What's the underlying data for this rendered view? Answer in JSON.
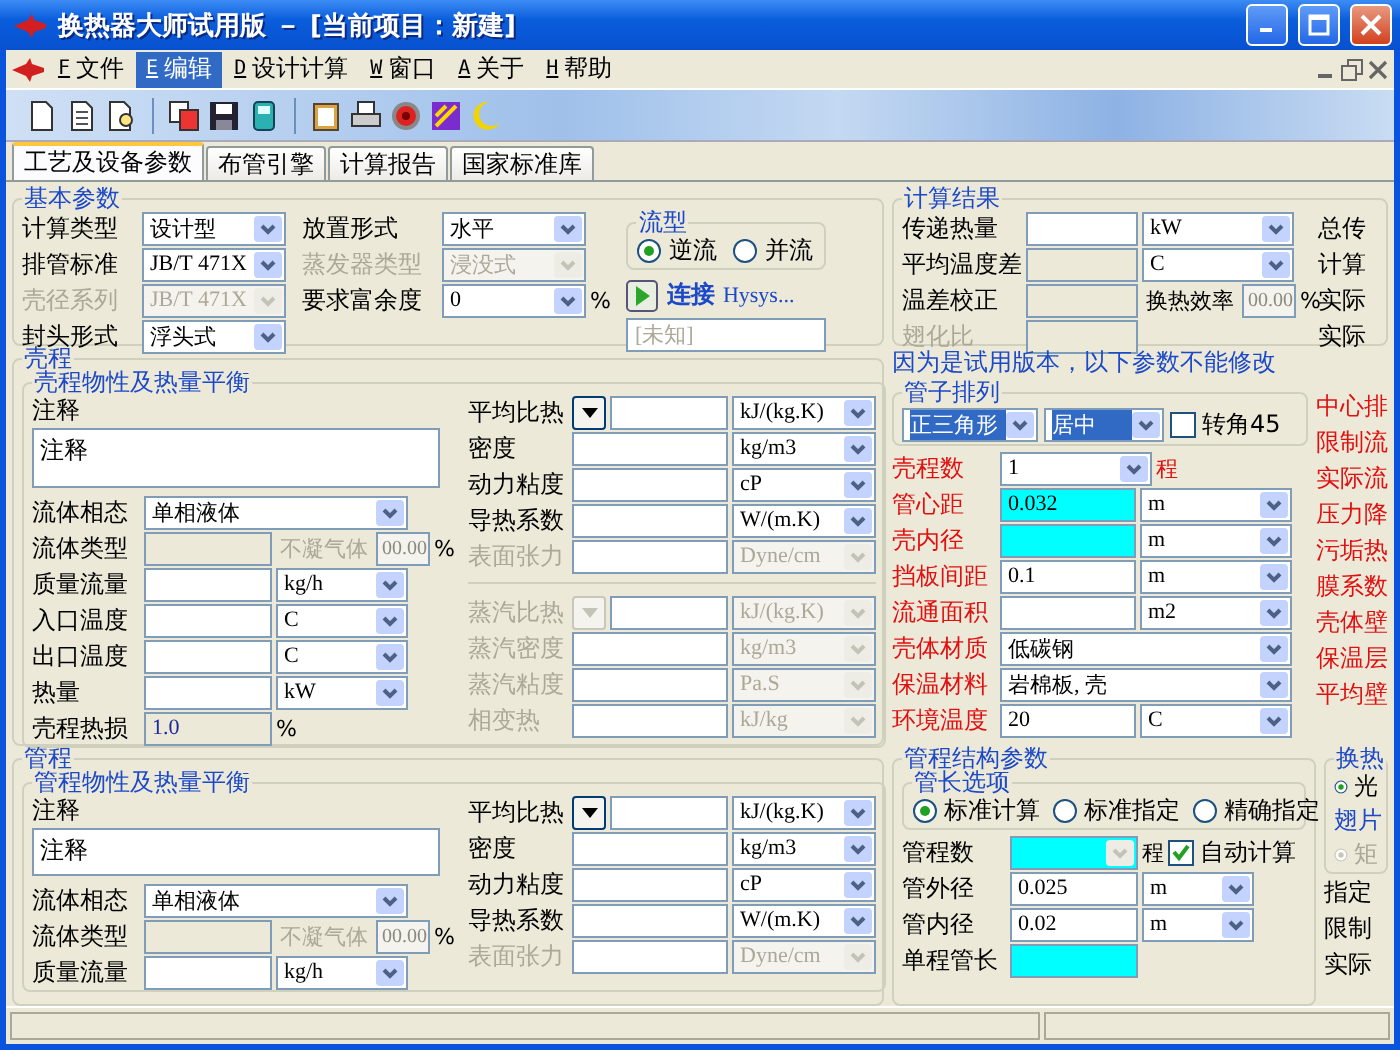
{
  "window": {
    "title": "换热器大师试用版 － [当前项目：新建]"
  },
  "menu": [
    {
      "key": "F",
      "label": "文件",
      "selected": false
    },
    {
      "key": "E",
      "label": "编辑",
      "selected": true
    },
    {
      "key": "D",
      "label": "设计计算",
      "selected": false
    },
    {
      "key": "W",
      "label": "窗口",
      "selected": false
    },
    {
      "key": "A",
      "label": "关于",
      "selected": false
    },
    {
      "key": "H",
      "label": "帮助",
      "selected": false
    }
  ],
  "tabs": [
    {
      "label": "工艺及设备参数",
      "selected": true
    },
    {
      "label": "布管引擎",
      "selected": false
    },
    {
      "label": "计算报告",
      "selected": false
    },
    {
      "label": "国家标准库",
      "selected": false
    }
  ],
  "basic": {
    "title": "基本参数",
    "column_1": [
      {
        "label": "计算类型",
        "disabled": false,
        "cells": [
          {
            "kind": "combo",
            "value": "设计型"
          }
        ]
      },
      {
        "label": "排管标准",
        "disabled": false,
        "cells": [
          {
            "kind": "combo",
            "value": "JB/T 471X"
          }
        ]
      },
      {
        "label": "壳径系列",
        "disabled": true,
        "cells": [
          {
            "kind": "combo",
            "value": "JB/T 471X"
          }
        ]
      },
      {
        "label": "封头形式",
        "disabled": false,
        "cells": [
          {
            "kind": "combo",
            "value": "浮头式"
          }
        ]
      }
    ],
    "column_2": [
      {
        "label": "放置形式",
        "disabled": false,
        "cells": [
          {
            "kind": "combo",
            "value": "水平"
          }
        ]
      },
      {
        "label": "蒸发器类型",
        "disabled": true,
        "cells": [
          {
            "kind": "combo",
            "value": "浸没式"
          }
        ]
      },
      {
        "label": "要求富余度",
        "disabled": false,
        "cells": [
          {
            "kind": "combo",
            "value": "0"
          },
          {
            "kind": "suffix",
            "value": "%"
          }
        ]
      }
    ],
    "flow": {
      "title": "流型",
      "options": [
        {
          "label": "逆流",
          "selected": true
        },
        {
          "label": "并流",
          "selected": false
        }
      ]
    },
    "connect": {
      "label": "连接",
      "target": "Hysys...",
      "status": "[未知]"
    }
  },
  "results": {
    "title": "计算结果",
    "rows": [
      {
        "label": "传递热量",
        "disabled": false,
        "cells": [
          {
            "kind": "input"
          },
          {
            "kind": "combo",
            "value": "kW"
          }
        ]
      },
      {
        "label": "平均温度差",
        "disabled": false,
        "cells": [
          {
            "kind": "gray"
          },
          {
            "kind": "combo",
            "value": "C"
          }
        ]
      },
      {
        "label": "温差校正",
        "disabled": false,
        "cells": [
          {
            "kind": "gray"
          },
          {
            "kind": "note",
            "value": "换热效率"
          },
          {
            "kind": "tiny",
            "value": "00.00"
          },
          {
            "kind": "suffix",
            "value": "%"
          }
        ]
      },
      {
        "label": "翅化比",
        "disabled": true,
        "cells": [
          {
            "kind": "gray"
          }
        ]
      }
    ],
    "side_labels": [
      "总传",
      "计算",
      "实际",
      "实际"
    ]
  },
  "shell": {
    "title": "壳程",
    "balance": {
      "title": "壳程物性及热量平衡",
      "note_label": "注释",
      "note": "注释",
      "rows": [
        {
          "label": "流体相态",
          "disabled": false,
          "cells": [
            {
              "kind": "wide",
              "value": "单相液体"
            }
          ]
        },
        {
          "label": "流体类型",
          "disabled": false,
          "cells": [
            {
              "kind": "gray"
            },
            {
              "kind": "hint",
              "value": "不凝气体"
            },
            {
              "kind": "tiny",
              "value": "00.00"
            },
            {
              "kind": "suffix",
              "value": "%"
            }
          ]
        },
        {
          "label": "质量流量",
          "disabled": false,
          "cells": [
            {
              "kind": "input"
            },
            {
              "kind": "combo",
              "value": "kg/h"
            }
          ]
        },
        {
          "label": "入口温度",
          "disabled": false,
          "cells": [
            {
              "kind": "input"
            },
            {
              "kind": "combo",
              "value": "C"
            }
          ]
        },
        {
          "label": "出口温度",
          "disabled": false,
          "cells": [
            {
              "kind": "input"
            },
            {
              "kind": "combo",
              "value": "C"
            }
          ]
        },
        {
          "label": "热量",
          "disabled": false,
          "cells": [
            {
              "kind": "input"
            },
            {
              "kind": "combo",
              "value": "kW"
            }
          ]
        },
        {
          "label": "壳程热损",
          "disabled": false,
          "cells": [
            {
              "kind": "gray",
              "value": "1.0"
            },
            {
              "kind": "suffix",
              "value": "%"
            }
          ]
        }
      ],
      "props": [
        {
          "label": "平均比热",
          "disabled": false,
          "cells": [
            {
              "kind": "drop"
            },
            {
              "kind": "input"
            },
            {
              "kind": "combo",
              "value": "kJ/(kg.K)"
            }
          ]
        },
        {
          "label": "密度",
          "disabled": false,
          "cells": [
            {
              "kind": "input"
            },
            {
              "kind": "combo",
              "value": "kg/m3"
            }
          ]
        },
        {
          "label": "动力粘度",
          "disabled": false,
          "cells": [
            {
              "kind": "input"
            },
            {
              "kind": "combo",
              "value": "cP"
            }
          ]
        },
        {
          "label": "导热系数",
          "disabled": false,
          "cells": [
            {
              "kind": "input"
            },
            {
              "kind": "combo",
              "value": "W/(m.K)"
            }
          ]
        },
        {
          "label": "表面张力",
          "disabled": true,
          "cells": [
            {
              "kind": "input"
            },
            {
              "kind": "combo",
              "value": "Dyne/cm"
            }
          ]
        }
      ],
      "vapor": [
        {
          "label": "蒸汽比热",
          "disabled": true,
          "cells": [
            {
              "kind": "drop"
            },
            {
              "kind": "input"
            },
            {
              "kind": "combo",
              "value": "kJ/(kg.K)"
            }
          ]
        },
        {
          "label": "蒸汽密度",
          "disabled": true,
          "cells": [
            {
              "kind": "input"
            },
            {
              "kind": "combo",
              "value": "kg/m3"
            }
          ]
        },
        {
          "label": "蒸汽粘度",
          "disabled": true,
          "cells": [
            {
              "kind": "input"
            },
            {
              "kind": "combo",
              "value": "Pa.S"
            }
          ]
        },
        {
          "label": "相变热",
          "disabled": true,
          "cells": [
            {
              "kind": "input"
            },
            {
              "kind": "combo",
              "value": "kJ/kg"
            }
          ]
        }
      ]
    },
    "notice": "因为是试用版本，以下参数不能修改",
    "layout": {
      "title": "管子排列",
      "pattern": "正三角形",
      "position": "居中",
      "rotate": {
        "label": "转角45",
        "checked": false
      }
    },
    "rows": [
      {
        "label": "壳程数",
        "disabled": false,
        "cells": [
          {
            "kind": "combo",
            "value": "1"
          },
          {
            "kind": "suffix",
            "value": "程"
          }
        ]
      },
      {
        "label": "管心距",
        "disabled": false,
        "cells": [
          {
            "kind": "cyan",
            "value": "0.032"
          },
          {
            "kind": "combo",
            "value": "m"
          }
        ]
      },
      {
        "label": "壳内径",
        "disabled": false,
        "cells": [
          {
            "kind": "cyan"
          },
          {
            "kind": "combo",
            "value": "m"
          }
        ]
      },
      {
        "label": "挡板间距",
        "disabled": false,
        "cells": [
          {
            "kind": "input",
            "value": "0.1"
          },
          {
            "kind": "combo",
            "value": "m"
          }
        ]
      },
      {
        "label": "流通面积",
        "disabled": false,
        "cells": [
          {
            "kind": "input"
          },
          {
            "kind": "combo",
            "value": "m2"
          }
        ]
      },
      {
        "label": "壳体材质",
        "disabled": false,
        "cells": [
          {
            "kind": "wide",
            "value": "低碳钢"
          }
        ]
      },
      {
        "label": "保温材料",
        "disabled": false,
        "cells": [
          {
            "kind": "wide",
            "value": "岩棉板, 壳"
          }
        ]
      },
      {
        "label": "环境温度",
        "disabled": false,
        "cells": [
          {
            "kind": "input",
            "value": "20"
          },
          {
            "kind": "combo",
            "value": "C"
          }
        ]
      }
    ],
    "side_labels": [
      "中心排",
      "限制流",
      "实际流",
      "压力降",
      "污垢热",
      "膜系数",
      "壳体壁",
      "保温层",
      "平均壁"
    ]
  },
  "tube": {
    "title": "管程",
    "balance": {
      "title": "管程物性及热量平衡",
      "note_label": "注释",
      "note": "注释",
      "rows": [
        {
          "label": "流体相态",
          "disabled": false,
          "cells": [
            {
              "kind": "wide",
              "value": "单相液体"
            }
          ]
        },
        {
          "label": "流体类型",
          "disabled": false,
          "cells": [
            {
              "kind": "gray"
            },
            {
              "kind": "hint",
              "value": "不凝气体"
            },
            {
              "kind": "tiny",
              "value": "00.00"
            },
            {
              "kind": "suffix",
              "value": "%"
            }
          ]
        },
        {
          "label": "质量流量",
          "disabled": false,
          "cells": [
            {
              "kind": "input"
            },
            {
              "kind": "combo",
              "value": "kg/h"
            }
          ]
        }
      ],
      "props": [
        {
          "label": "平均比热",
          "disabled": false,
          "cells": [
            {
              "kind": "drop"
            },
            {
              "kind": "input"
            },
            {
              "kind": "combo",
              "value": "kJ/(kg.K)"
            }
          ]
        },
        {
          "label": "密度",
          "disabled": false,
          "cells": [
            {
              "kind": "input"
            },
            {
              "kind": "combo",
              "value": "kg/m3"
            }
          ]
        },
        {
          "label": "动力粘度",
          "disabled": false,
          "cells": [
            {
              "kind": "input"
            },
            {
              "kind": "combo",
              "value": "cP"
            }
          ]
        },
        {
          "label": "导热系数",
          "disabled": false,
          "cells": [
            {
              "kind": "input"
            },
            {
              "kind": "combo",
              "value": "W/(m.K)"
            }
          ]
        },
        {
          "label": "表面张力",
          "disabled": true,
          "cells": [
            {
              "kind": "input"
            },
            {
              "kind": "combo",
              "value": "Dyne/cm"
            }
          ]
        }
      ]
    },
    "structure": {
      "title": "管程结构参数",
      "length_title": "管长选项",
      "length_options": [
        {
          "label": "标准计算",
          "selected": true
        },
        {
          "label": "标准指定",
          "selected": false
        },
        {
          "label": "精确指定",
          "selected": false
        }
      ],
      "rows": [
        {
          "label": "管程数",
          "disabled": false,
          "cells": [
            {
              "kind": "cyan_combo"
            },
            {
              "kind": "suffix",
              "value": "程"
            },
            {
              "kind": "check",
              "value": "自动计算",
              "checked": true
            }
          ]
        },
        {
          "label": "管外径",
          "disabled": false,
          "cells": [
            {
              "kind": "input",
              "value": "0.025"
            },
            {
              "kind": "combo",
              "value": "m"
            }
          ]
        },
        {
          "label": "管内径",
          "disabled": false,
          "cells": [
            {
              "kind": "input",
              "value": "0.02"
            },
            {
              "kind": "combo",
              "value": "m"
            }
          ]
        },
        {
          "label": "单程管长",
          "disabled": false,
          "cells": [
            {
              "kind": "cyan"
            }
          ]
        }
      ]
    },
    "exchange": {
      "title": "换热",
      "options": [
        {
          "label": "光",
          "selected": true
        }
      ],
      "fin_title": "翅片",
      "fin_options": [
        {
          "label": "矩",
          "selected": true
        }
      ],
      "side_labels": [
        "指定",
        "限制",
        "实际"
      ]
    }
  }
}
